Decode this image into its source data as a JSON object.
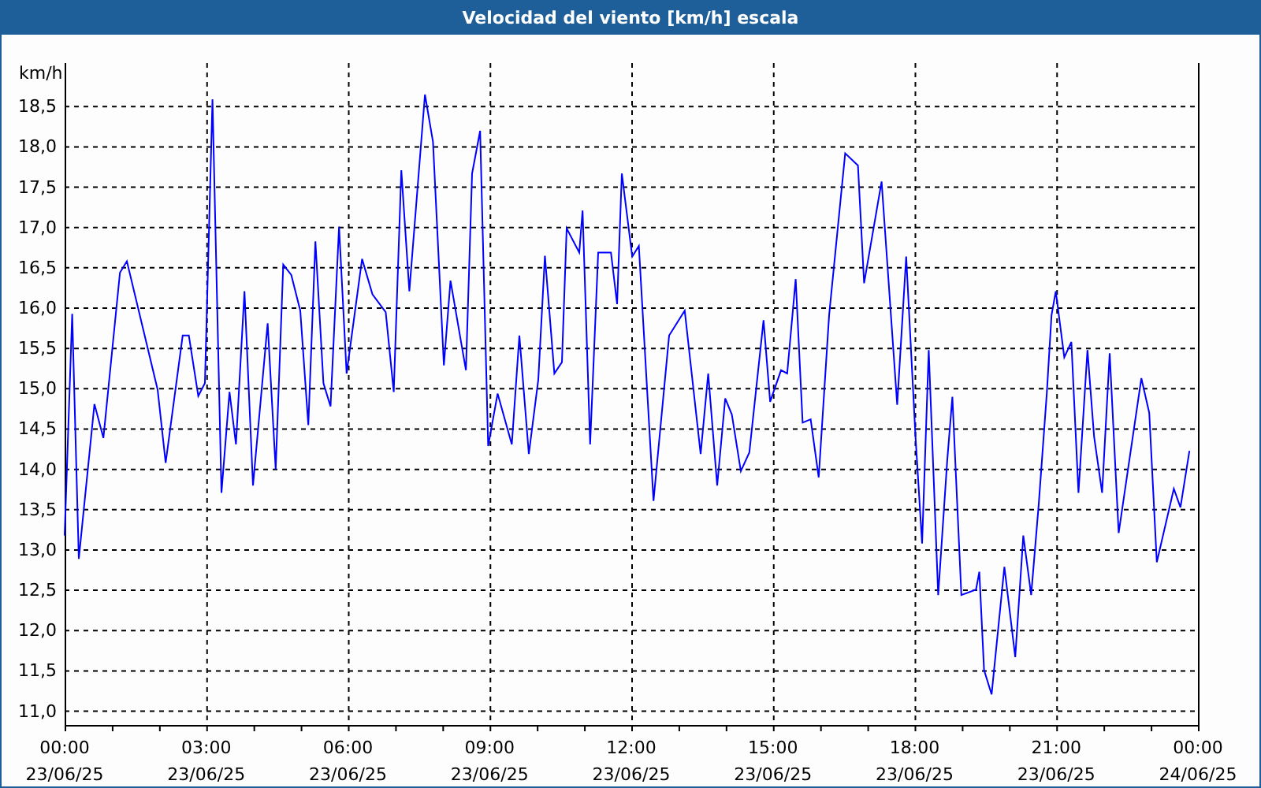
{
  "window": {
    "title": "Velocidad del viento [km/h] escala"
  },
  "chart_data": {
    "type": "line",
    "ylabel": "km/h",
    "x": [
      0,
      0.16,
      0.3,
      0.63,
      0.82,
      1.17,
      1.32,
      1.97,
      2.14,
      2.5,
      2.63,
      2.83,
      2.97,
      3.13,
      3.32,
      3.49,
      3.63,
      3.81,
      3.99,
      4.3,
      4.47,
      4.63,
      4.8,
      4.99,
      5.16,
      5.31,
      5.48,
      5.63,
      5.81,
      5.97,
      6.3,
      6.52,
      6.8,
      6.97,
      7.13,
      7.3,
      7.63,
      7.8,
      8.03,
      8.17,
      8.5,
      8.63,
      8.8,
      8.97,
      9.17,
      9.47,
      9.63,
      9.83,
      10.03,
      10.17,
      10.37,
      10.53,
      10.63,
      10.9,
      10.97,
      11.13,
      11.3,
      11.57,
      11.7,
      11.8,
      12.02,
      12.16,
      12.47,
      12.8,
      13.13,
      13.47,
      13.63,
      13.82,
      13.99,
      14.13,
      14.32,
      14.5,
      14.8,
      14.94,
      15.17,
      15.3,
      15.48,
      15.63,
      15.8,
      15.97,
      16.19,
      16.53,
      16.8,
      16.93,
      17.3,
      17.63,
      17.82,
      18.02,
      18.16,
      18.3,
      18.5,
      18.69,
      18.8,
      18.99,
      19.3,
      19.37,
      19.47,
      19.63,
      19.9,
      20.13,
      20.3,
      20.47,
      20.63,
      20.8,
      20.9,
      20.99,
      21.17,
      21.32,
      21.47,
      21.66,
      21.8,
      21.97,
      22.13,
      22.32,
      22.8,
      22.97,
      23.13,
      23.49,
      23.63,
      23.82
    ],
    "values": [
      13.17,
      15.92,
      12.88,
      14.8,
      14.38,
      16.43,
      16.57,
      14.98,
      14.07,
      15.65,
      15.65,
      14.9,
      15.06,
      18.58,
      13.7,
      14.95,
      14.3,
      16.2,
      13.79,
      15.8,
      13.99,
      16.53,
      16.4,
      15.96,
      14.54,
      16.82,
      15.06,
      14.77,
      17.0,
      15.18,
      16.6,
      16.16,
      15.94,
      14.95,
      17.7,
      16.2,
      18.64,
      18.05,
      15.28,
      16.33,
      15.22,
      17.66,
      18.19,
      14.28,
      14.93,
      14.3,
      15.65,
      14.18,
      15.1,
      16.64,
      15.18,
      15.32,
      16.98,
      16.68,
      17.2,
      14.3,
      16.68,
      16.68,
      16.04,
      17.66,
      16.63,
      16.76,
      13.6,
      15.65,
      15.96,
      14.18,
      15.18,
      13.79,
      14.87,
      14.67,
      13.97,
      14.2,
      15.84,
      14.83,
      15.22,
      15.18,
      16.35,
      14.57,
      14.61,
      13.89,
      15.9,
      17.91,
      17.76,
      16.3,
      17.56,
      14.79,
      16.63,
      14.4,
      13.07,
      15.47,
      12.43,
      14.09,
      14.89,
      12.43,
      12.5,
      12.72,
      11.5,
      11.2,
      12.78,
      11.66,
      13.17,
      12.43,
      13.56,
      14.93,
      15.9,
      16.2,
      15.38,
      15.57,
      13.7,
      15.47,
      14.4,
      13.7,
      15.43,
      13.2,
      15.12,
      14.69,
      12.84,
      13.75,
      13.52,
      14.22
    ],
    "xlim": [
      0,
      24
    ],
    "ylim": [
      10.82,
      19.03
    ],
    "xticks": [
      {
        "value": 0,
        "label": "00:00"
      },
      {
        "value": 3,
        "label": "03:00"
      },
      {
        "value": 6,
        "label": "06:00"
      },
      {
        "value": 9,
        "label": "09:00"
      },
      {
        "value": 12,
        "label": "12:00"
      },
      {
        "value": 15,
        "label": "15:00"
      },
      {
        "value": 18,
        "label": "18:00"
      },
      {
        "value": 21,
        "label": "21:00"
      },
      {
        "value": 24,
        "label": "00:00"
      }
    ],
    "annotations": [
      "23/06/25",
      "23/06/25",
      "23/06/25",
      "23/06/25",
      "23/06/25",
      "23/06/25",
      "23/06/25",
      "23/06/25",
      "24/06/25"
    ],
    "grid": true,
    "yticks": [
      {
        "value": 11,
        "label": "11,0"
      },
      {
        "value": 11.5,
        "label": "11,5"
      },
      {
        "value": 12,
        "label": "12,0"
      },
      {
        "value": 12.5,
        "label": "12,5"
      },
      {
        "value": 13,
        "label": "13,0"
      },
      {
        "value": 13.5,
        "label": "13,5"
      },
      {
        "value": 14,
        "label": "14,0"
      },
      {
        "value": 14.5,
        "label": "14,5"
      },
      {
        "value": 15,
        "label": "15,0"
      },
      {
        "value": 15.5,
        "label": "15,5"
      },
      {
        "value": 16,
        "label": "16,0"
      },
      {
        "value": 16.5,
        "label": "16,5"
      },
      {
        "value": 17,
        "label": "17,0"
      },
      {
        "value": 17.5,
        "label": "17,5"
      },
      {
        "value": 18,
        "label": "18,0"
      },
      {
        "value": 18.5,
        "label": "18,5"
      }
    ]
  }
}
